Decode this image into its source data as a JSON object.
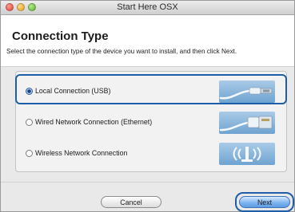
{
  "window": {
    "title": "Start Here OSX"
  },
  "header": {
    "title": "Connection Type",
    "instructions": "Select the connection type of the device you want to install, and then click Next."
  },
  "options": [
    {
      "label": "Local Connection (USB)",
      "selected": true,
      "icon": "usb-cable-icon"
    },
    {
      "label": "Wired Network Connection (Ethernet)",
      "selected": false,
      "icon": "ethernet-cable-icon"
    },
    {
      "label": "Wireless Network Connection",
      "selected": false,
      "icon": "wireless-signal-icon"
    }
  ],
  "buttons": {
    "cancel": "Cancel",
    "next": "Next"
  },
  "colors": {
    "accent": "#1e5ea8",
    "thumb_bg": "#8fbbe0"
  }
}
